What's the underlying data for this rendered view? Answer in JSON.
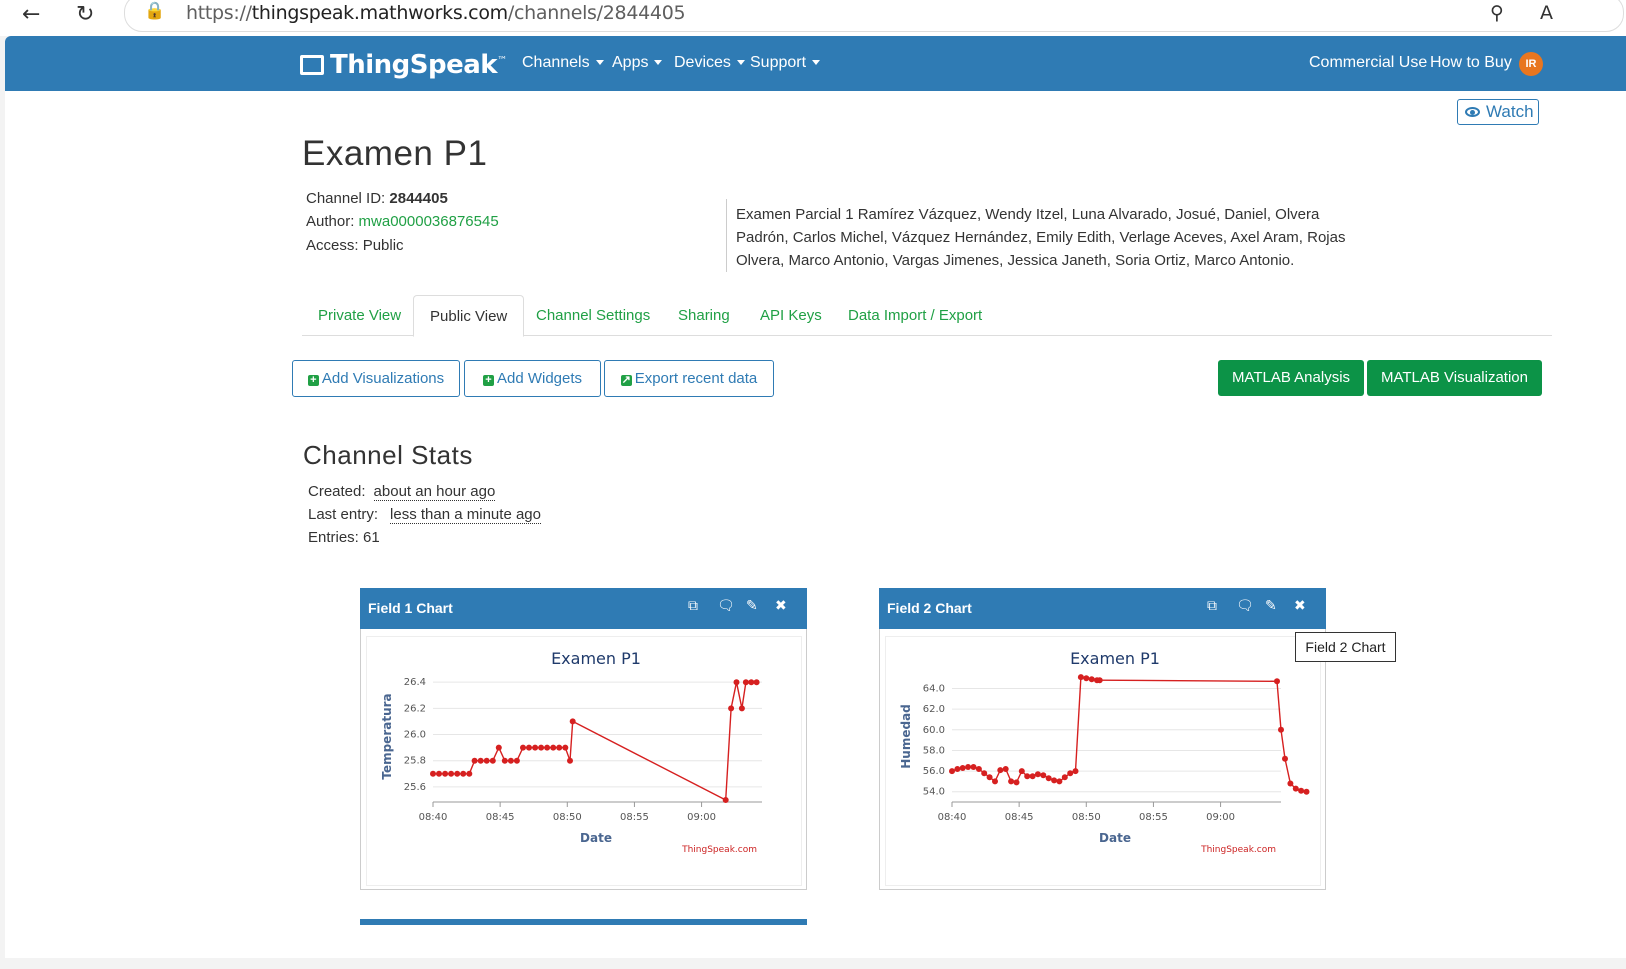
{
  "browser": {
    "url_prefix": "https://",
    "url_host": "thingspeak.mathworks.com",
    "url_path": "/channels/2844405"
  },
  "nav": {
    "logo": "ThingSpeak",
    "logo_tm": "™",
    "items": [
      "Channels",
      "Apps",
      "Devices",
      "Support"
    ],
    "right_items": [
      "Commercial Use",
      "How to Buy"
    ],
    "avatar": "IR"
  },
  "watch_label": "Watch",
  "channel": {
    "title": "Examen P1",
    "id_label": "Channel ID:",
    "id": "2844405",
    "author_label": "Author:",
    "author": "mwa0000036876545",
    "access_label": "Access:",
    "access": "Public",
    "description": "Examen Parcial 1 Ramírez Vázquez, Wendy Itzel, Luna Alvarado, Josué, Daniel, Olvera Padrón, Carlos Michel, Vázquez Hernández, Emily Edith, Verlage Aceves, Axel Aram, Rojas Olvera, Marco Antonio, Vargas Jimenes, Jessica Janeth, Soria Ortiz, Marco Antonio."
  },
  "tabs": [
    "Private View",
    "Public View",
    "Channel Settings",
    "Sharing",
    "API Keys",
    "Data Import / Export"
  ],
  "buttons": {
    "add_visualizations": "Add Visualizations",
    "add_widgets": "Add Widgets",
    "export_recent": "Export recent data",
    "matlab_analysis": "MATLAB Analysis",
    "matlab_visualization": "MATLAB Visualization"
  },
  "stats": {
    "title": "Channel Stats",
    "created_label": "Created:",
    "created": "about an hour ago",
    "last_entry_label": "Last entry:",
    "last_entry": "less than a minute ago",
    "entries_label": "Entries:",
    "entries": "61"
  },
  "tooltip": "Field 2 Chart",
  "icons": [
    "back-arrow-icon",
    "reload-icon",
    "lock-icon",
    "zoom-icon",
    "read-aloud-icon",
    "eye-icon",
    "external-link-icon",
    "comment-icon",
    "pencil-icon",
    "close-icon"
  ],
  "colors": {
    "navbar": "#2f7bb4",
    "green": "#20a045",
    "matlab_green": "#0c9347",
    "series": "#d62020",
    "chart_title": "#1f3a6b"
  },
  "chart_data": [
    {
      "type": "line",
      "panel_title": "Field 1 Chart",
      "title": "Examen P1",
      "xlabel": "Date",
      "ylabel": "Temperatura",
      "credit": "ThingSpeak.com",
      "x_ticks": [
        "08:40",
        "08:45",
        "08:50",
        "08:55",
        "09:00"
      ],
      "y_ticks": [
        "25.6",
        "25.8",
        "26.0",
        "26.2",
        "26.4"
      ],
      "xlim": [
        0,
        24.5
      ],
      "ylim": [
        25.5,
        26.47
      ],
      "grid": true,
      "x": [
        0,
        0.45,
        0.9,
        1.35,
        1.8,
        2.25,
        2.7,
        3.1,
        3.55,
        4.0,
        4.45,
        4.9,
        5.35,
        5.8,
        6.25,
        6.7,
        7.15,
        7.6,
        8.05,
        8.5,
        8.95,
        9.4,
        9.85,
        10.2,
        10.4,
        21.8,
        22.2,
        22.6,
        23.0,
        23.3,
        23.7,
        24.1
      ],
      "y": [
        25.7,
        25.7,
        25.7,
        25.7,
        25.7,
        25.7,
        25.7,
        25.8,
        25.8,
        25.8,
        25.8,
        25.9,
        25.8,
        25.8,
        25.8,
        25.9,
        25.9,
        25.9,
        25.9,
        25.9,
        25.9,
        25.9,
        25.9,
        25.8,
        26.1,
        25.5,
        26.2,
        26.4,
        26.2,
        26.4,
        26.4,
        26.4
      ]
    },
    {
      "type": "line",
      "panel_title": "Field 2 Chart",
      "title": "Examen P1",
      "xlabel": "Date",
      "ylabel": "Humedad",
      "credit": "ThingSpeak.com",
      "x_ticks": [
        "08:40",
        "08:45",
        "08:50",
        "08:55",
        "09:00"
      ],
      "y_ticks": [
        "54.0",
        "56.0",
        "58.0",
        "60.0",
        "62.0",
        "64.0"
      ],
      "xlim": [
        0,
        24.5
      ],
      "ylim": [
        53.2,
        65.5
      ],
      "grid": true,
      "x": [
        0,
        0.4,
        0.8,
        1.2,
        1.6,
        2.0,
        2.4,
        2.8,
        3.2,
        3.6,
        4.0,
        4.4,
        4.8,
        5.2,
        5.6,
        6.0,
        6.4,
        6.8,
        7.2,
        7.6,
        8.0,
        8.4,
        8.8,
        9.2,
        9.6,
        10.0,
        10.4,
        10.8,
        11.0,
        24.2,
        24.5,
        24.8,
        25.2,
        25.6,
        26.0,
        26.4
      ],
      "y": [
        56.0,
        56.2,
        56.3,
        56.4,
        56.4,
        56.2,
        55.8,
        55.4,
        55.0,
        56.1,
        56.2,
        55.0,
        54.9,
        56.0,
        55.5,
        55.5,
        55.7,
        55.6,
        55.3,
        55.1,
        55.0,
        55.4,
        55.8,
        56.0,
        65.1,
        65.0,
        64.9,
        64.8,
        64.8,
        64.7,
        60.0,
        57.2,
        54.8,
        54.3,
        54.1,
        54.0
      ]
    }
  ]
}
